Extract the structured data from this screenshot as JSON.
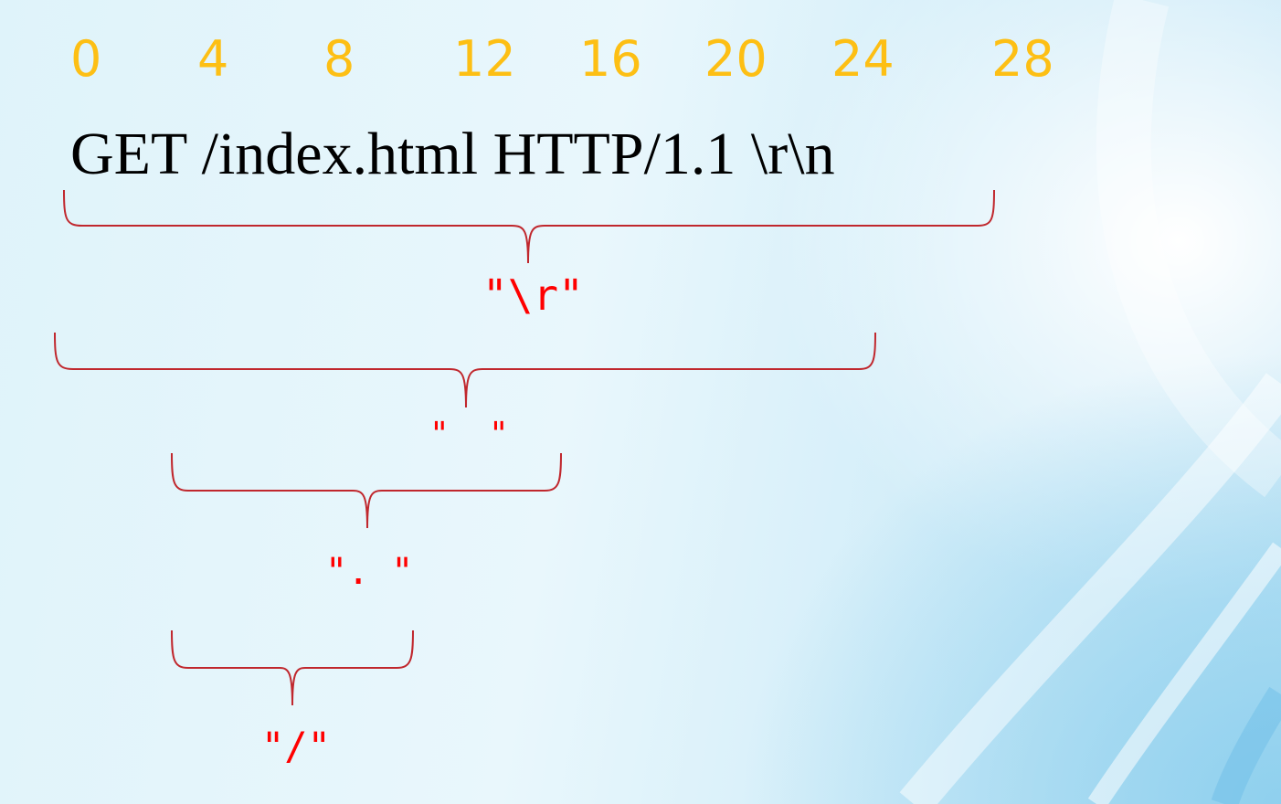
{
  "ticks": [
    "0",
    "4",
    "8",
    "12",
    "16",
    "20",
    "24",
    "28"
  ],
  "request_line": "GET /index.html HTTP/1.1 \\r\\n",
  "delimiters": {
    "cr": "\"\\r\"",
    "space": "\"  \"",
    "dot": "\". \"",
    "slash": "\"/\""
  },
  "colors": {
    "tick": "#fdbf14",
    "brace": "#c0272d",
    "delimiter": "#ff0000"
  }
}
